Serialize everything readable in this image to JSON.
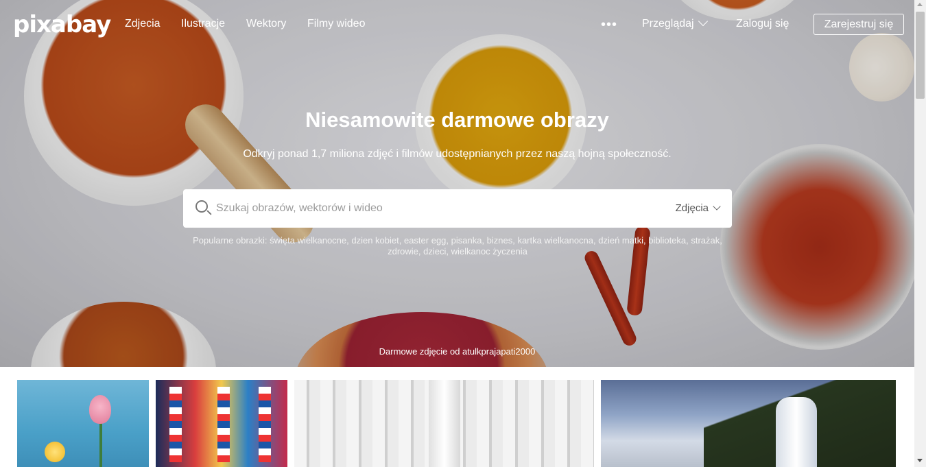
{
  "header": {
    "logo": "pixabay",
    "nav": [
      "Zdjecia",
      "Ilustracje",
      "Wektory",
      "Filmy wideo"
    ],
    "more_icon": "•••",
    "browse_label": "Przeglądaj",
    "login_label": "Zaloguj się",
    "register_label": "Zarejestruj się"
  },
  "hero": {
    "title": "Niesamowite darmowe obrazy",
    "subtitle": "Odkryj ponad 1,7 miliona zdjęć i filmów udostępnianych przez naszą hojną społeczność.",
    "search": {
      "placeholder": "Szukaj obrazów, wektorów i wideo",
      "value": "",
      "type_label": "Zdjęcia"
    },
    "popular": "Popularne obrazki: święta wielkanocne, dzien kobiet, easter egg, pisanka, biznes, kartka wielkanocna, dzień matki, biblioteka, strażak, zdrowie, dzieci, wielkanoc życzenia",
    "credit": "Darmowe zdjęcie od atulkprajapati2000"
  },
  "icons": {
    "search": "search-icon",
    "more": "more-icon",
    "chevron": "chevron-down-icon"
  },
  "colors": {
    "text_on_hero": "#ffffff",
    "search_placeholder": "#9b9b9b"
  }
}
